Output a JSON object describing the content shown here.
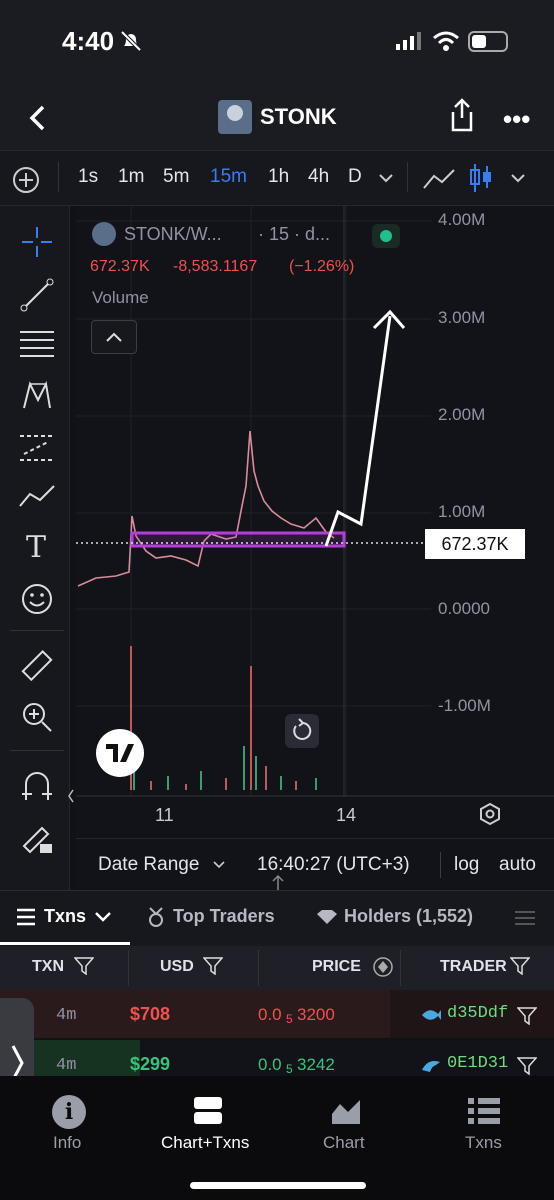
{
  "status_bar": {
    "time": "4:40"
  },
  "header": {
    "title": "STONK"
  },
  "toolbar": {
    "timeframes": [
      "1s",
      "1m",
      "5m",
      "15m",
      "1h",
      "4h",
      "D"
    ],
    "active_timeframe": "15m"
  },
  "legend": {
    "symbol": "STONK/W...",
    "interval": "· 15 · d...",
    "price_line": "672.37K",
    "change": "-8,583.1167",
    "change_pct": "(−1.26%)",
    "volume_label": "Volume"
  },
  "y_axis": {
    "ticks": [
      "4.00M",
      "3.00M",
      "2.00M",
      "1.00M",
      "0.0000",
      "-1.00M"
    ]
  },
  "x_axis": {
    "ticks": [
      "11",
      "14"
    ]
  },
  "price_tag": "672.37K",
  "chart_footer": {
    "date_range": "Date Range",
    "clock": "16:40:27 (UTC+3)",
    "log": "log",
    "auto": "auto"
  },
  "tabs": {
    "txns": "Txns",
    "top_traders": "Top Traders",
    "holders": "Holders (1,552)"
  },
  "columns": {
    "txn": "TXN",
    "usd": "USD",
    "price": "PRICE",
    "trader": "TRADER"
  },
  "rows": [
    {
      "age": "4m",
      "usd": "$708",
      "price_a": "0.0",
      "price_sub": "5",
      "price_b": "3200",
      "trader": "d35Ddf",
      "side": "sell"
    },
    {
      "age": "4m",
      "usd": "$299",
      "price_a": "0.0",
      "price_sub": "5",
      "price_b": "3242",
      "trader": "0E1D31",
      "side": "buy"
    }
  ],
  "nav": {
    "info": "Info",
    "chart_txns": "Chart+Txns",
    "chart": "Chart",
    "txns": "Txns"
  },
  "colors": {
    "accent": "#3a7df0",
    "sell": "#f0514d",
    "buy": "#37c47a",
    "highlight": "#b340d6"
  }
}
